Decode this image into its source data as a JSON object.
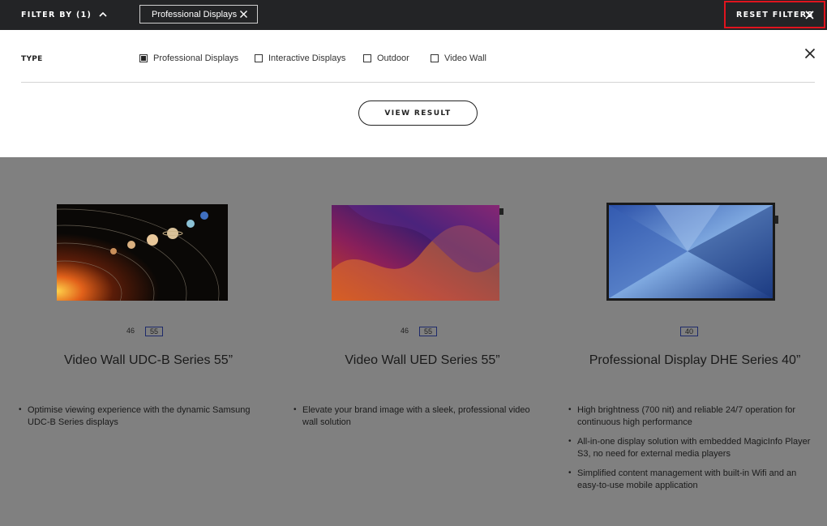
{
  "topbar": {
    "filter_by_label": "FILTER BY (1)",
    "active_chip": "Professional Displays",
    "reset_label": "RESET FILTERS"
  },
  "filter_panel": {
    "type_label": "TYPE",
    "options": [
      {
        "label": "Professional Displays",
        "checked": true
      },
      {
        "label": "Interactive Displays",
        "checked": false
      },
      {
        "label": "Outdoor",
        "checked": false
      },
      {
        "label": "Video Wall",
        "checked": false
      }
    ],
    "view_result_label": "VIEW RESULT"
  },
  "products": [
    {
      "sizes": [
        "46",
        "55"
      ],
      "selected_size": "55",
      "title": "Video Wall UDC-B Series 55”",
      "bullets": [
        "Optimise viewing experience with the dynamic Samsung UDC-B Series displays"
      ]
    },
    {
      "sizes": [
        "46",
        "55"
      ],
      "selected_size": "55",
      "title": "Video Wall UED Series 55”",
      "bullets": [
        "Elevate your brand image with a sleek, professional video wall solution"
      ]
    },
    {
      "sizes": [
        "40"
      ],
      "selected_size": "40",
      "title": "Professional Display DHE Series 40”",
      "bullets": [
        "High brightness (700 nit) and reliable 24/7 operation for continuous high performance",
        "All-in-one display solution with embedded MagicInfo Player S3, no need for external media players",
        "Simplified content management with built-in Wifi and an easy-to-use mobile application"
      ]
    }
  ],
  "colors": {
    "topbar_bg": "#232426",
    "overlay_bg": "#808080",
    "reset_border": "#e0141e",
    "size_box_border": "#1e2a6a"
  },
  "icons": {
    "filter_toggle": "chevron-up-icon",
    "chip_remove": "close-icon",
    "reset": "close-icon",
    "panel_close": "close-icon"
  }
}
